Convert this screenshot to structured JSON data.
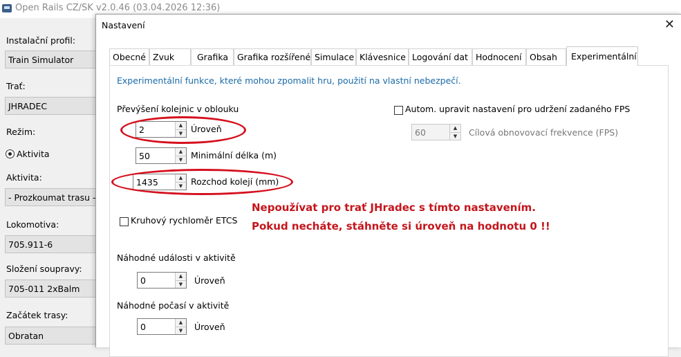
{
  "main_window": {
    "title": "Open Rails CZ/SK v2.0.46 (03.04.2026 12:36)",
    "install_profile_label": "Instalační profil:",
    "install_profile_value": "Train Simulator",
    "route_label": "Trať:",
    "route_value": "JHRADEC",
    "mode_label": "Režim:",
    "mode_option": "Aktivita",
    "activity_label": "Aktivita:",
    "activity_value": "- Prozkoumat trasu -",
    "loco_label": "Lokomotiva:",
    "loco_value": "705.911-6",
    "consist_label": "Složení soupravy:",
    "consist_value": "705-011 2xBalm",
    "path_start_label": "Začátek trasy:",
    "path_start_value": "Obratan"
  },
  "dialog": {
    "title": "Nastavení",
    "tabs": [
      {
        "label": "Obecné"
      },
      {
        "label": "Zvuk"
      },
      {
        "label": "Grafika"
      },
      {
        "label": "Grafika rozšířené"
      },
      {
        "label": "Simulace"
      },
      {
        "label": "Klávesnice"
      },
      {
        "label": "Logování dat"
      },
      {
        "label": "Hodnocení"
      },
      {
        "label": "Obsah"
      },
      {
        "label": "Experimentální"
      }
    ],
    "info_text": "Experimentální funkce, které mohou zpomalit hru, použití na vlastní nebezpečí.",
    "superelevation": {
      "heading": "Převýšení kolejnic v oblouku",
      "level_value": "2",
      "level_label": "Úroveň",
      "min_length_value": "50",
      "min_length_label": "Minimální délka (m)",
      "gauge_value": "1435",
      "gauge_label": "Rozchod kolejí (mm)"
    },
    "auto_fps": {
      "label": "Autom. upravit nastavení pro udržení zadaného FPS",
      "value": "60",
      "target_label": "Cílová obnovovací frekvence (FPS)"
    },
    "etcs_label": "Kruhový rychloměr ETCS",
    "random_events": {
      "heading": "Náhodné události v aktivitě",
      "value": "0",
      "label": "Úroveň"
    },
    "random_weather": {
      "heading": "Náhodné počasí v aktivitě",
      "value": "0",
      "label": "Úroveň"
    }
  },
  "annotation": {
    "line1": "Nepoužívat pro trať JHradec s tímto nastavením.",
    "line2": "Pokud necháte, stáhněte si úroveň na hodnotu 0 !!",
    "color": "#c4161c"
  }
}
